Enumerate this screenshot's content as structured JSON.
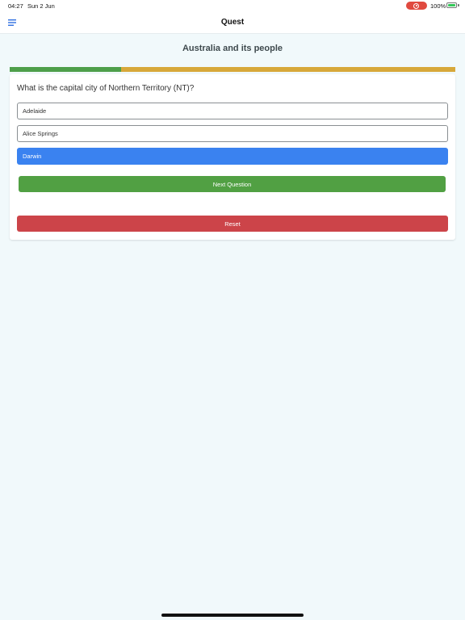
{
  "status_bar": {
    "time": "04:27",
    "date": "Sun 2 Jun",
    "battery_text": "100%",
    "battery_level": 1.0,
    "record_color": "#e04a3f"
  },
  "header": {
    "menu_icon": "hamburger-menu-icon",
    "title": "Quest"
  },
  "quiz": {
    "title": "Australia and its people",
    "progress": 0.25,
    "progress_colors": {
      "done": "#4e9f4a",
      "remaining": "#d7a83a"
    },
    "question": "What is the capital city of Northern Territory (NT)?",
    "options": [
      {
        "label": "Adelaide",
        "selected": false
      },
      {
        "label": "Alice Springs",
        "selected": false
      },
      {
        "label": "Darwin",
        "selected": true
      }
    ],
    "next_label": "Next Question",
    "reset_label": "Reset",
    "colors": {
      "selected": "#3a82f0",
      "next": "#51a043",
      "reset": "#cc4449"
    }
  }
}
